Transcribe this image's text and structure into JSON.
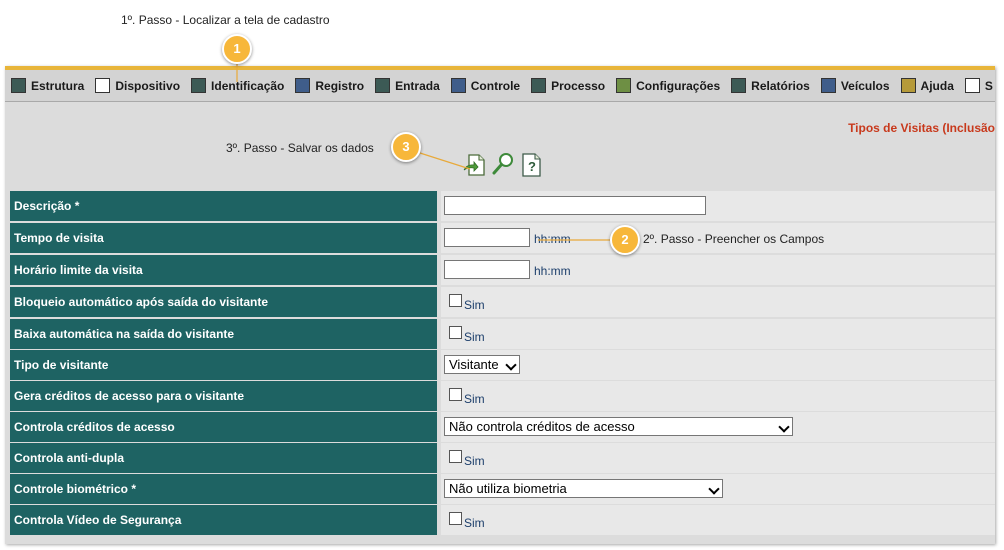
{
  "annotations": {
    "step1": "1º. Passo - Localizar a tela de cadastro",
    "step2": "2º. Passo - Preencher os Campos",
    "step3": "3º. Passo - Salvar os dados",
    "badge1": "1",
    "badge2": "2",
    "badge3": "3"
  },
  "menu": [
    {
      "label": "Estrutura",
      "icon": "structure-icon"
    },
    {
      "label": "Dispositivo",
      "icon": "device-icon"
    },
    {
      "label": "Identificação",
      "icon": "identification-icon"
    },
    {
      "label": "Registro",
      "icon": "registry-icon"
    },
    {
      "label": "Entrada",
      "icon": "entry-icon"
    },
    {
      "label": "Controle",
      "icon": "control-icon"
    },
    {
      "label": "Processo",
      "icon": "process-icon"
    },
    {
      "label": "Configurações",
      "icon": "settings-icon"
    },
    {
      "label": "Relatórios",
      "icon": "reports-icon"
    },
    {
      "label": "Veículos",
      "icon": "vehicles-icon"
    },
    {
      "label": "Ajuda",
      "icon": "help-icon"
    },
    {
      "label": "S",
      "icon": "truncated-icon"
    }
  ],
  "page": {
    "title": "Tipos de Visitas (Inclusão"
  },
  "toolbar": {
    "save_icon": "save-icon",
    "search_icon": "search-icon",
    "help_icon": "help-icon"
  },
  "form": {
    "descricao_label": "Descrição *",
    "descricao_value": "",
    "tempo_label": "Tempo de visita",
    "tempo_value": "",
    "tempo_hint": "hh:mm",
    "horario_label": "Horário limite da visita",
    "horario_value": "",
    "horario_hint": "hh:mm",
    "bloqueio_label": "Bloqueio automático após saída do visitante",
    "bloqueio_check": "Sim",
    "baixa_label": "Baixa automática na saída do visitante",
    "baixa_check": "Sim",
    "tipo_label": "Tipo de visitante",
    "tipo_value": "Visitante",
    "gera_label": "Gera créditos de acesso para o visitante",
    "gera_check": "Sim",
    "controla_label": "Controla créditos de acesso",
    "controla_value": "Não controla créditos de acesso",
    "antidupla_label": "Controla anti-dupla",
    "antidupla_check": "Sim",
    "biometrico_label": "Controle biométrico *",
    "biometrico_value": "Não utiliza biometria",
    "video_label": "Controla Vídeo de Segurança",
    "video_check": "Sim"
  },
  "colors": {
    "label_bg": "#1e6363",
    "accent": "#e8b53a",
    "title": "#c8391c",
    "callout": "#f7b73a"
  }
}
